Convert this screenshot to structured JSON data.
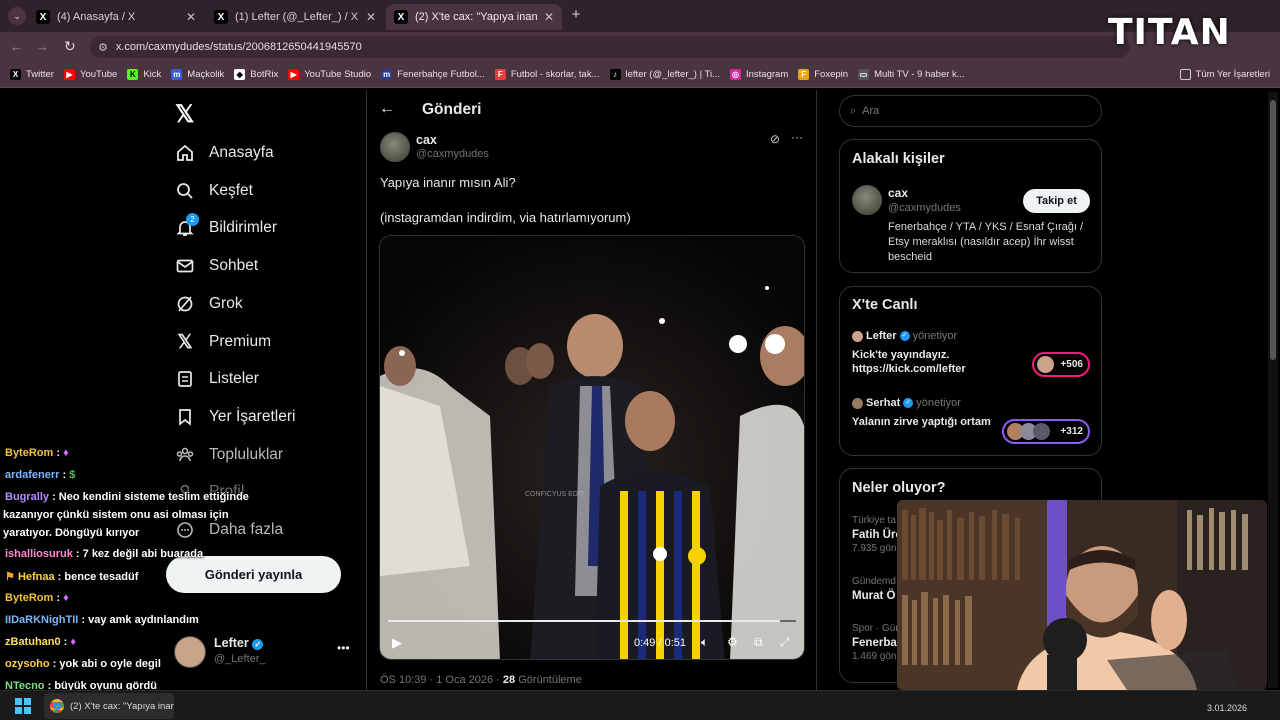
{
  "browser": {
    "tabs": [
      {
        "title": "(4) Anasayfa / X",
        "active": false
      },
      {
        "title": "(1) Lefter (@_Lefter_) / X",
        "active": false
      },
      {
        "title": "(2) X'te cax: \"Yapıya inanır mısın",
        "active": true
      }
    ],
    "new_tab": "+",
    "url": "x.com/caxmydudes/status/2006812650441945570",
    "bookmarks": [
      "Twitter",
      "YouTube",
      "Kick",
      "Maçkolik",
      "BotRix",
      "YouTube Studio",
      "Fenerbahçe Futbol...",
      "Futbol - skorlar, tak...",
      "lefter (@_lefter_) | Ti...",
      "Instagram",
      "Foxepin",
      "Multi TV - 9 haber k..."
    ],
    "all_bookmarks": "Tüm Yer İşaretleri"
  },
  "watermark": "TITAN",
  "nav": {
    "items": [
      "Anasayfa",
      "Keşfet",
      "Bildirimler",
      "Sohbet",
      "Grok",
      "Premium",
      "Listeler",
      "Yer İşaretleri",
      "Topluluklar",
      "Profil",
      "Daha fazla"
    ],
    "notif_badge": "2",
    "post_button": "Gönderi yayınla",
    "account_name": "Lefter",
    "account_handle": "@_Lefter_"
  },
  "post": {
    "header": "Gönderi",
    "author": "cax",
    "handle": "@caxmydudes",
    "text1": "Yapıya inanır mısın Ali?",
    "text2": "(instagramdan indirdim, via hatırlamıyorum)",
    "video_time": "0:49 / 0:51",
    "video_progress": 0.96,
    "video_watermark": "CONFICYUS EDIT",
    "timestamp": "ÖS 10:39 · 1 Oca 2026 ·",
    "views_count": "28",
    "views_label": "Görüntüleme"
  },
  "right": {
    "search_placeholder": "Ara",
    "related_title": "Alakalı kişiler",
    "related_name": "cax",
    "related_handle": "@caxmydudes",
    "follow_button": "Takip et",
    "related_bio": "Fenerbahçe / YTA / YKS / Esnaf Çırağı / Etsy meraklısı (nasıldır acep) İhr wisst bescheid",
    "live_title": "X'te Canlı",
    "live": [
      {
        "name": "Lefter",
        "role": "yönetiyor",
        "text": "Kick'te yayındayız. https://kick.com/lefter",
        "count": "+506"
      },
      {
        "name": "Serhat",
        "role": "yönetiyor",
        "text": "Yalanın zirve yaptığı ortam",
        "count": "+312"
      }
    ],
    "trends_title": "Neler oluyor?",
    "trends": [
      {
        "cat": "Türkiye ta",
        "name": "Fatih Üre",
        "count": "7.935 gönd"
      },
      {
        "cat": "Gündemd",
        "name": "Murat Ö",
        "count": ""
      },
      {
        "cat": "Spor · Gün",
        "name": "Fenerba",
        "count": "1.469 gön"
      }
    ]
  },
  "chat": [
    {
      "user": "ByteRom",
      "msg": ""
    },
    {
      "user": "ardafenerr",
      "msg": ""
    },
    {
      "user": "Bugrally",
      "msg": "Neo kendini sisteme teslim ettiğinde"
    },
    {
      "user": "",
      "msg": "kazanıyor çünkü sistem onu asi olması için"
    },
    {
      "user": "",
      "msg": "yaratıyor. Döngüyü kırıyor"
    },
    {
      "user": "ishalliosuruk",
      "msg": "7 kez değil abi buarada"
    },
    {
      "user": "Hefnaa",
      "msg": "bence tesadüf"
    },
    {
      "user": "ByteRom",
      "msg": ""
    },
    {
      "user": "IIDaRKNighTII",
      "msg": "vay amk aydınlandım"
    },
    {
      "user": "zBatuhan0",
      "msg": ""
    },
    {
      "user": "ozysoho",
      "msg": "yok abi o oyle degil"
    },
    {
      "user": "NTecno",
      "msg": "büyük oyunu gördü"
    }
  ],
  "taskbar": {
    "window_title": "(2) X'te cax: \"Yapıya inar",
    "date": "3.01.2026"
  },
  "colors": {
    "accent": "#1d9bf0",
    "chrome": "#4a3440",
    "live_ring": "#f91880"
  }
}
